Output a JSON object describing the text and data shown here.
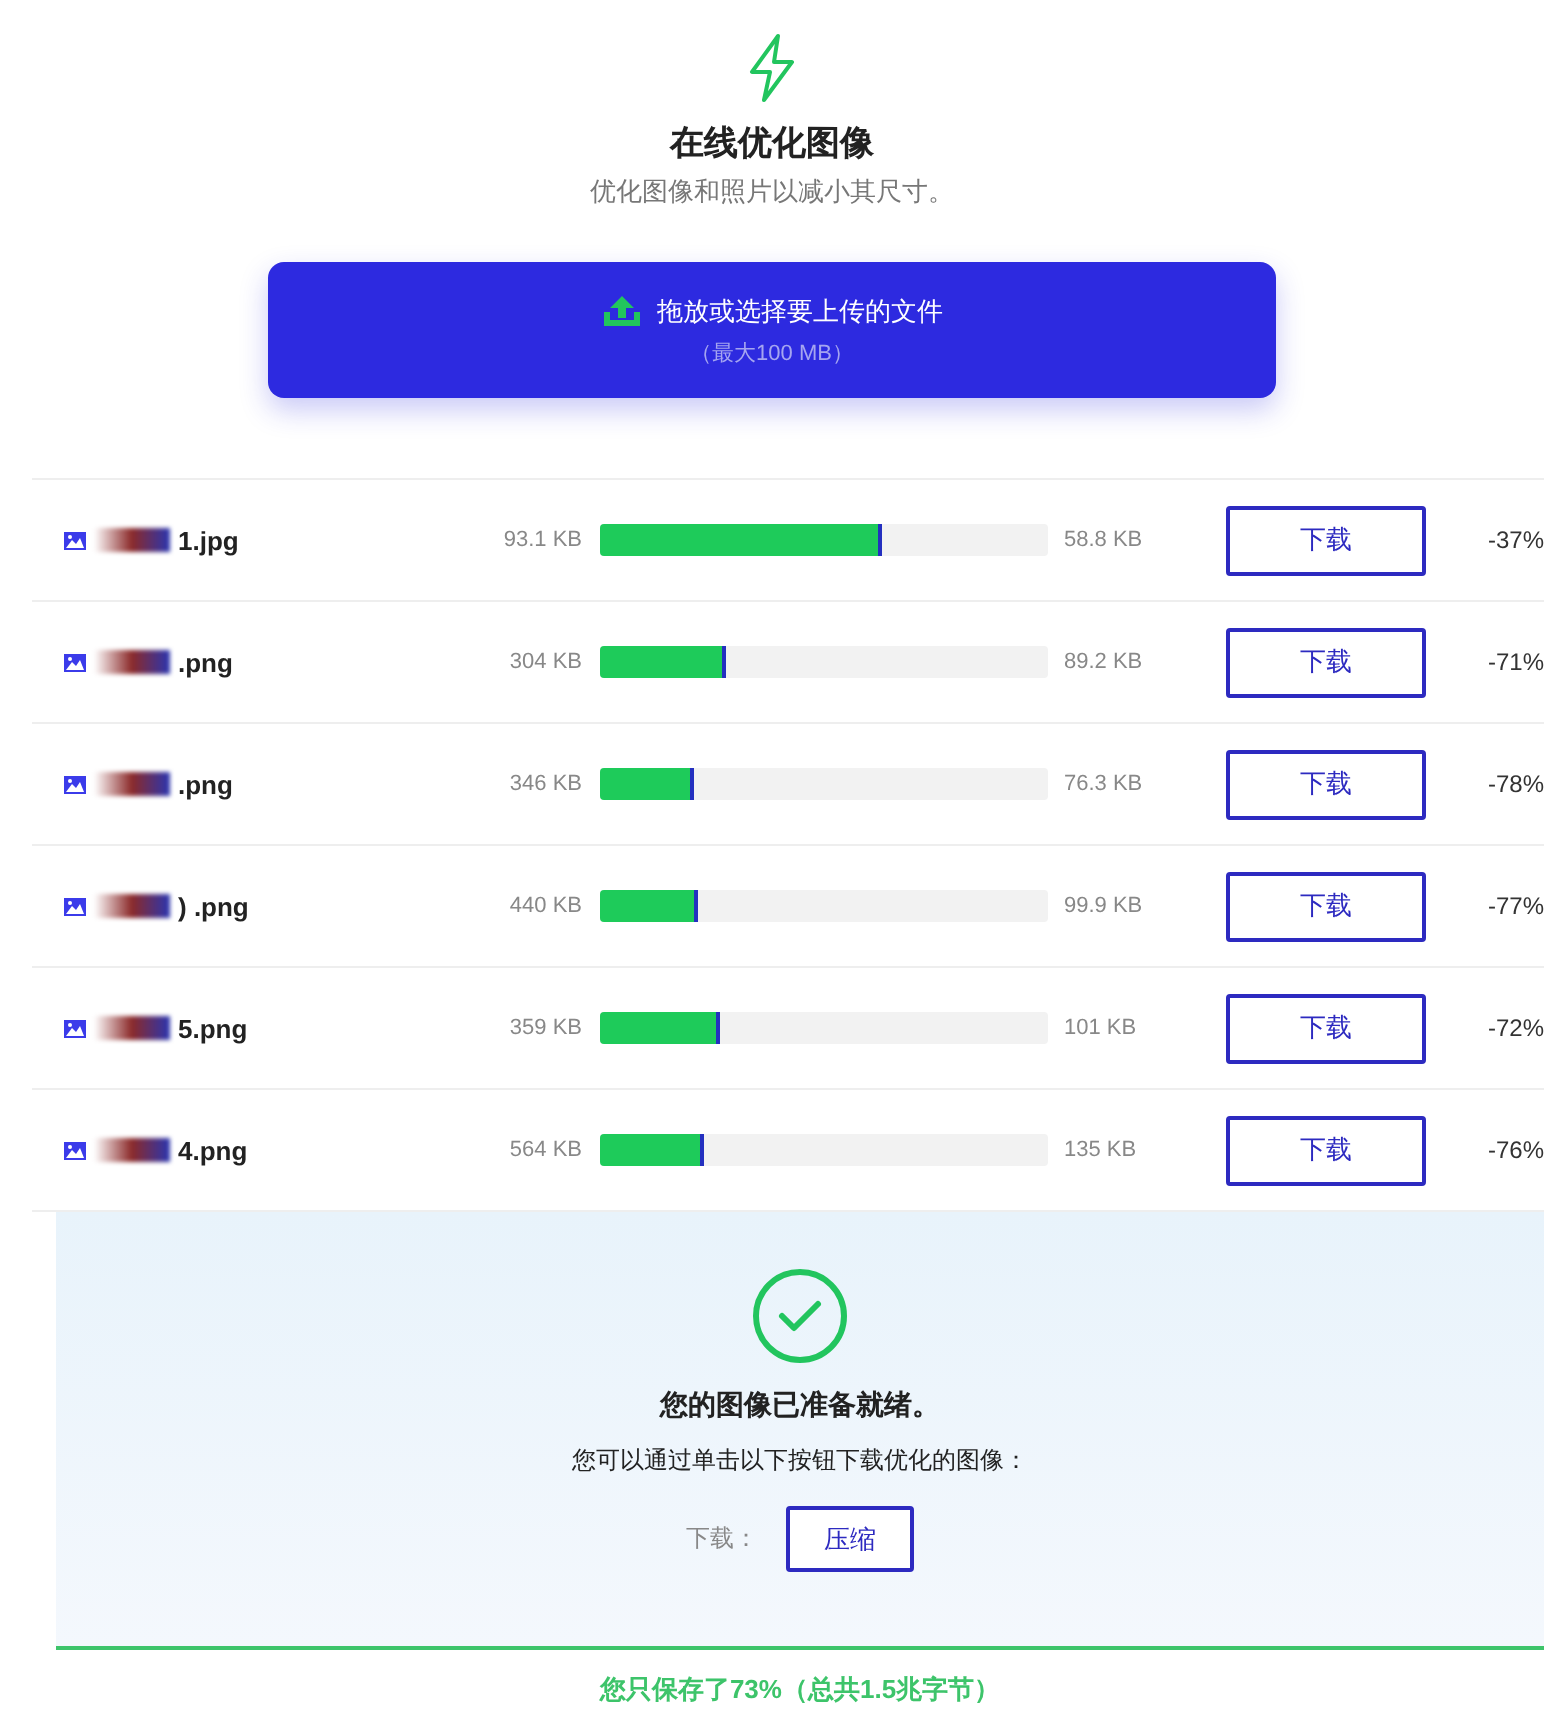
{
  "header": {
    "title": "在线优化图像",
    "subtitle": "优化图像和照片以减小其尺寸。"
  },
  "upload": {
    "label": "拖放或选择要上传的文件",
    "hint": "（最大100 MB）"
  },
  "files": [
    {
      "name": "1.jpg",
      "original_size": "93.1 KB",
      "level": 0.63,
      "new_size": "58.8 KB",
      "button": "下载",
      "saving": "-37%"
    },
    {
      "name": ".png",
      "original_size": "304 KB",
      "level": 0.28,
      "new_size": "89.2 KB",
      "button": "下载",
      "saving": "-71%"
    },
    {
      "name": ".png",
      "original_size": "346 KB",
      "level": 0.21,
      "new_size": "76.3 KB",
      "button": "下载",
      "saving": "-78%"
    },
    {
      "name": ") .png",
      "original_size": "440 KB",
      "level": 0.22,
      "new_size": "99.9 KB",
      "button": "下载",
      "saving": "-77%"
    },
    {
      "name": "5.png",
      "original_size": "359 KB",
      "level": 0.27,
      "new_size": "101 KB",
      "button": "下载",
      "saving": "-72%"
    },
    {
      "name": "4.png",
      "original_size": "564 KB",
      "level": 0.23,
      "new_size": "135 KB",
      "button": "下载",
      "saving": "-76%"
    }
  ],
  "result": {
    "title": "您的图像已准备就绪。",
    "text": "您可以通过单击以下按钮下载优化的图像：",
    "download_label": "下载：",
    "download_button": "压缩"
  },
  "summary": "您只保存了73%（总共1.5兆字节）"
}
